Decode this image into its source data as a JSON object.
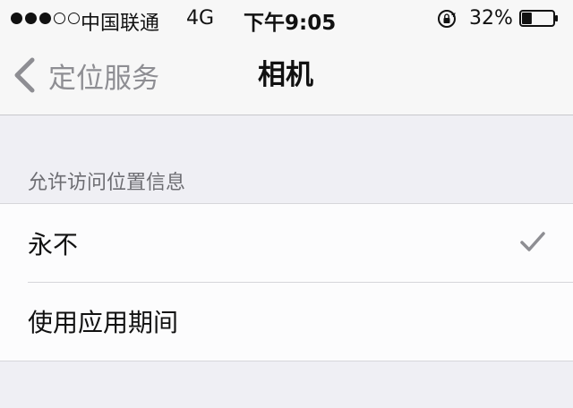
{
  "status_bar": {
    "signal_bars_filled": 3,
    "signal_bars_total": 5,
    "carrier": "中国联通",
    "network": "4G",
    "time": "下午9:05",
    "battery_percent": "32%",
    "battery_level": 0.32
  },
  "nav": {
    "back_label": "定位服务",
    "title": "相机"
  },
  "section": {
    "header": "允许访问位置信息",
    "options": [
      {
        "label": "永不",
        "selected": true
      },
      {
        "label": "使用应用期间",
        "selected": false
      }
    ]
  },
  "colors": {
    "background": "#efeff4",
    "bar_background": "#f7f7f7",
    "back_gray": "#8e8e93",
    "checkmark_gray": "#8e8e93",
    "section_header": "#6d6d72"
  }
}
